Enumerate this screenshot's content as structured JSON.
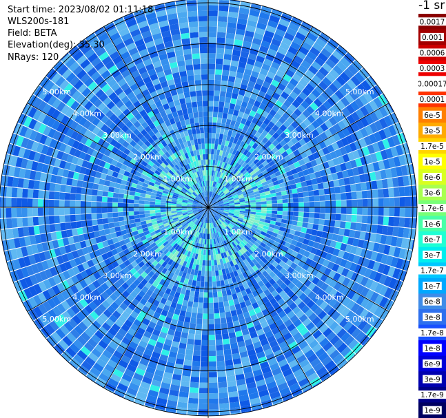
{
  "info": {
    "start_time": "Start time: 2023/08/02 01:11:18",
    "instrument": "WLS200s-181",
    "field": "Field: BETA",
    "elevation": "Elevation(deg): 35.30",
    "nrays": "NRays: 120"
  },
  "colorbar": {
    "title": "-1 sr",
    "labels": [
      "0.0017",
      "0.001",
      "0.0006",
      "0.0003",
      "0.00017",
      "0.0001",
      "6e-5",
      "3e-5",
      "1.7e-5",
      "1e-5",
      "6e-6",
      "3e-6",
      "1.7e-6",
      "1e-6",
      "6e-7",
      "3e-7",
      "1.7e-7",
      "1e-7",
      "6e-8",
      "3e-8",
      "1.7e-8",
      "1e-8",
      "6e-9",
      "3e-9",
      "1.7e-9",
      "1e-9"
    ],
    "colors": [
      "#8b0000",
      "#a30000",
      "#cc0000",
      "#ee0000",
      "#ffffff",
      "#ff3300",
      "#ff7f00",
      "#ffaa00",
      "#ffd400",
      "#ffff00",
      "#d8ff20",
      "#a8ff50",
      "#78ff78",
      "#48ffa8",
      "#20ffd4",
      "#00eeee",
      "#00c8ff",
      "#00a8ff",
      "#3e8ce8",
      "#2e70ee",
      "#1850ff",
      "#0000ff",
      "#0000d8",
      "#0000b0",
      "#000088",
      "#000060"
    ]
  },
  "chart_data": {
    "type": "heatmap",
    "projection": "polar-ppi",
    "range_rings_km": [
      1,
      2,
      3,
      4,
      5
    ],
    "range_labels": [
      "1.00km",
      "2.00km",
      "3.00km",
      "4.00km",
      "5.00km"
    ],
    "spoke_interval_deg": 30,
    "nrays": 120,
    "max_range_km": 5.1,
    "field": "BETA",
    "value_range": [
      1e-09,
      0.0017
    ],
    "color_scale": "log",
    "data_colors": [
      "#0f5ae6",
      "#1f78ec",
      "#3590ee",
      "#4aa8f0",
      "#2e7fe8",
      "#1a64e6",
      "#5fb8f2",
      "#2ff0e8",
      "#54eed8",
      "#8af0c8"
    ],
    "grid": true
  }
}
